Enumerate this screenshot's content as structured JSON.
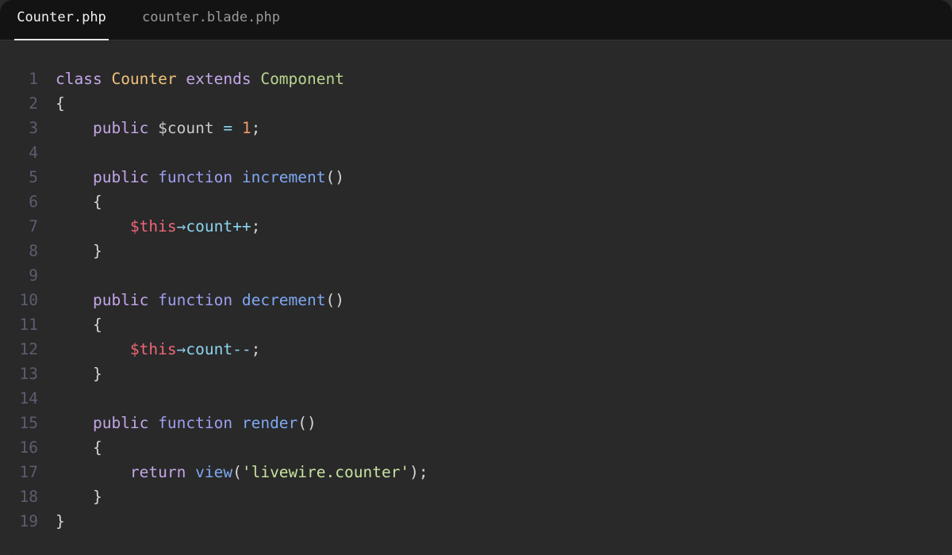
{
  "tabs": [
    {
      "label": "Counter.php",
      "active": true
    },
    {
      "label": "counter.blade.php",
      "active": false
    }
  ],
  "colors": {
    "background": "#292929",
    "tabbar": "#131313",
    "keyword": "#c3a6e8",
    "class_name": "#f1c27d",
    "parent_class": "#b9d58f",
    "number": "#f19a68",
    "method": "#7fa8f2",
    "this_var": "#ef6777",
    "property": "#8cd5f0",
    "string": "#c7e3a0",
    "line_number": "#5b5e70"
  },
  "code": {
    "lines": [
      {
        "n": "1",
        "tokens": [
          [
            "kw",
            "class"
          ],
          [
            "punc",
            " "
          ],
          [
            "cls",
            "Counter"
          ],
          [
            "punc",
            " "
          ],
          [
            "kw",
            "extends"
          ],
          [
            "punc",
            " "
          ],
          [
            "parent",
            "Component"
          ]
        ]
      },
      {
        "n": "2",
        "tokens": [
          [
            "punc",
            "{"
          ]
        ]
      },
      {
        "n": "3",
        "tokens": [
          [
            "punc",
            "    "
          ],
          [
            "kw",
            "public"
          ],
          [
            "punc",
            " "
          ],
          [
            "var",
            "$count"
          ],
          [
            "punc",
            " "
          ],
          [
            "op",
            "="
          ],
          [
            "punc",
            " "
          ],
          [
            "num",
            "1"
          ],
          [
            "punc",
            ";"
          ]
        ]
      },
      {
        "n": "4",
        "tokens": []
      },
      {
        "n": "5",
        "tokens": [
          [
            "punc",
            "    "
          ],
          [
            "kw",
            "public"
          ],
          [
            "punc",
            " "
          ],
          [
            "fnkw",
            "function"
          ],
          [
            "punc",
            " "
          ],
          [
            "meth",
            "increment"
          ],
          [
            "punc",
            "()"
          ]
        ]
      },
      {
        "n": "6",
        "tokens": [
          [
            "punc",
            "    {"
          ]
        ]
      },
      {
        "n": "7",
        "tokens": [
          [
            "punc",
            "        "
          ],
          [
            "this",
            "$this"
          ],
          [
            "arrow",
            "→"
          ],
          [
            "prop",
            "count"
          ],
          [
            "op",
            "++"
          ],
          [
            "punc",
            ";"
          ]
        ]
      },
      {
        "n": "8",
        "tokens": [
          [
            "punc",
            "    }"
          ]
        ]
      },
      {
        "n": "9",
        "tokens": []
      },
      {
        "n": "10",
        "tokens": [
          [
            "punc",
            "    "
          ],
          [
            "kw",
            "public"
          ],
          [
            "punc",
            " "
          ],
          [
            "fnkw",
            "function"
          ],
          [
            "punc",
            " "
          ],
          [
            "meth",
            "decrement"
          ],
          [
            "punc",
            "()"
          ]
        ]
      },
      {
        "n": "11",
        "tokens": [
          [
            "punc",
            "    {"
          ]
        ]
      },
      {
        "n": "12",
        "tokens": [
          [
            "punc",
            "        "
          ],
          [
            "this",
            "$this"
          ],
          [
            "arrow",
            "→"
          ],
          [
            "prop",
            "count"
          ],
          [
            "op",
            "--"
          ],
          [
            "punc",
            ";"
          ]
        ]
      },
      {
        "n": "13",
        "tokens": [
          [
            "punc",
            "    }"
          ]
        ]
      },
      {
        "n": "14",
        "tokens": []
      },
      {
        "n": "15",
        "tokens": [
          [
            "punc",
            "    "
          ],
          [
            "kw",
            "public"
          ],
          [
            "punc",
            " "
          ],
          [
            "fnkw",
            "function"
          ],
          [
            "punc",
            " "
          ],
          [
            "meth",
            "render"
          ],
          [
            "punc",
            "()"
          ]
        ]
      },
      {
        "n": "16",
        "tokens": [
          [
            "punc",
            "    {"
          ]
        ]
      },
      {
        "n": "17",
        "tokens": [
          [
            "punc",
            "        "
          ],
          [
            "kw",
            "return"
          ],
          [
            "punc",
            " "
          ],
          [
            "meth",
            "view"
          ],
          [
            "punc",
            "("
          ],
          [
            "str",
            "'livewire.counter'"
          ],
          [
            "punc",
            ");"
          ]
        ]
      },
      {
        "n": "18",
        "tokens": [
          [
            "punc",
            "    }"
          ]
        ]
      },
      {
        "n": "19",
        "tokens": [
          [
            "punc",
            "}"
          ]
        ]
      }
    ]
  }
}
